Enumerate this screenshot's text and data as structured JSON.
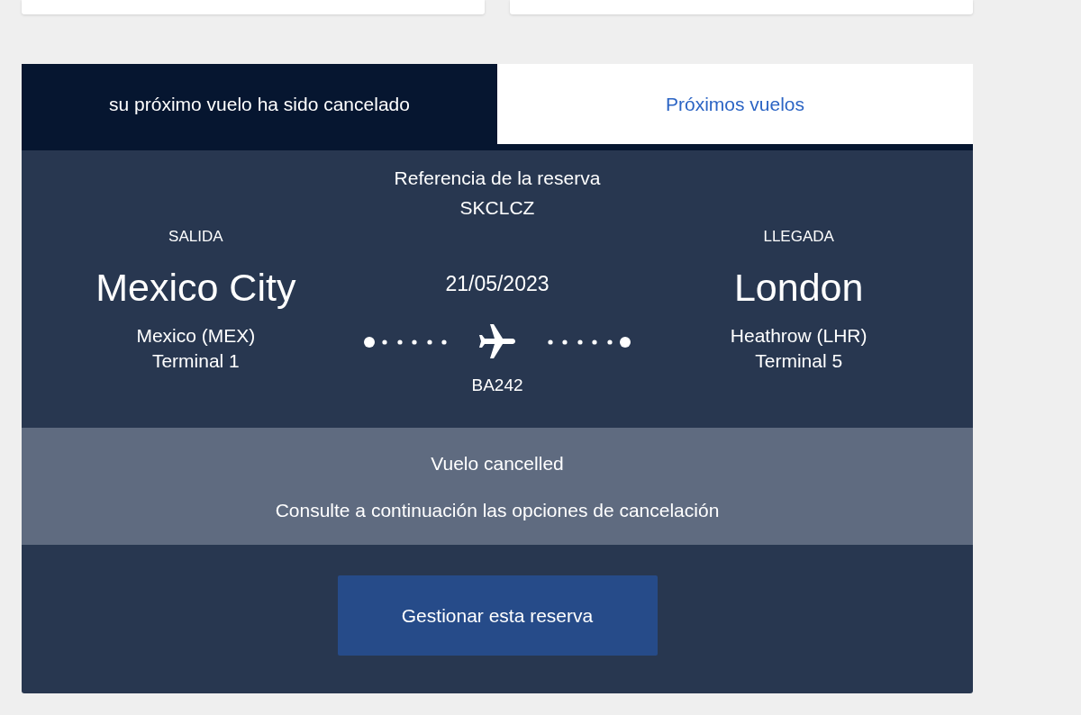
{
  "tabs": [
    {
      "label": "su próximo vuelo ha sido cancelado",
      "selected": true
    },
    {
      "label": "Próximos vuelos",
      "selected": false
    }
  ],
  "booking": {
    "reference_label": "Referencia de la reserva",
    "reference": "SKCLCZ"
  },
  "departure": {
    "label": "SALIDA",
    "city": "Mexico City",
    "airport": "Mexico (MEX)",
    "terminal": "Terminal 1"
  },
  "flight": {
    "date": "21/05/2023",
    "number": "BA242"
  },
  "arrival": {
    "label": "LLEGADA",
    "city": "London",
    "airport": "Heathrow (LHR)",
    "terminal": "Terminal 5"
  },
  "status": {
    "title": "Vuelo cancelled",
    "message": "Consulte a continuación las opciones de cancelación"
  },
  "button": {
    "label": "Gestionar esta reserva"
  }
}
